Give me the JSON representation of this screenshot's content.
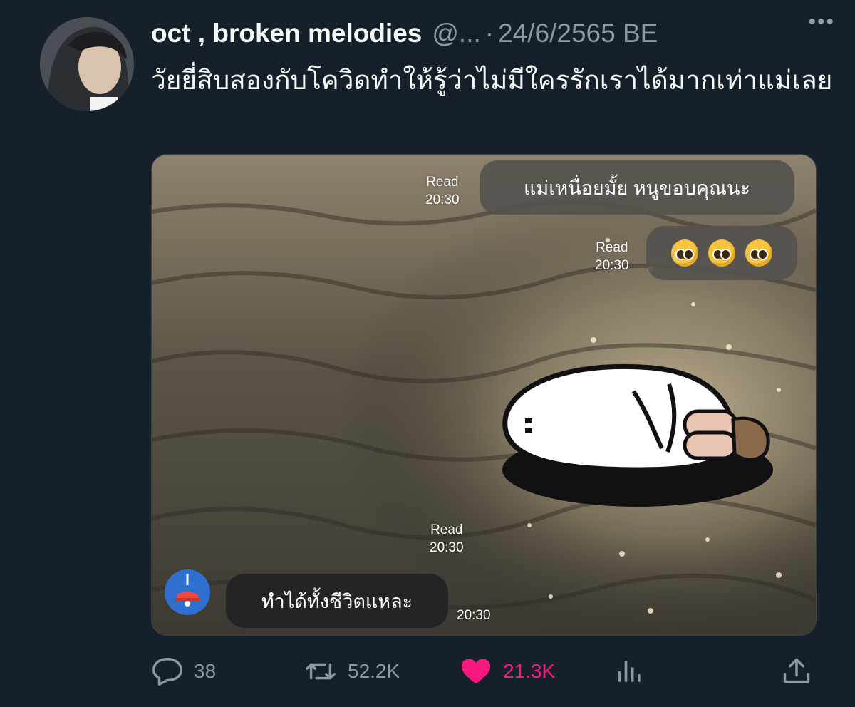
{
  "tweet": {
    "author_name": "oct , broken melodies",
    "handle": "@...",
    "separator": "·",
    "date": "24/6/2565 BE",
    "text": "วัยยี่สิบสองกับโควิดทำให้รู้ว่าไม่มีใครรักเราได้มากเท่าแม่เลย"
  },
  "chat": {
    "msg1": {
      "text": "แม่เหนื่อยมั้ย หนูขอบคุณนะ",
      "read_label": "Read",
      "time": "20:30"
    },
    "msg2": {
      "emojis": [
        "pleading-face",
        "pleading-face",
        "pleading-face"
      ],
      "read_label": "Read",
      "time": "20:30"
    },
    "sticker": {
      "name": "sleeping-character-sticker",
      "read_label": "Read",
      "time": "20:30"
    },
    "reply": {
      "text": "ทำได้ทั้งชีวิตแหละ",
      "time": "20:30"
    }
  },
  "actions": {
    "replies": "38",
    "retweets": "52.2K",
    "likes": "21.3K"
  },
  "colors": {
    "background": "#15202b",
    "text_primary": "#f7f9f9",
    "text_secondary": "#8b98a5",
    "like_active": "#f91880"
  },
  "icons": [
    "more-icon",
    "reply-icon",
    "retweet-icon",
    "like-icon",
    "views-icon",
    "share-icon"
  ]
}
